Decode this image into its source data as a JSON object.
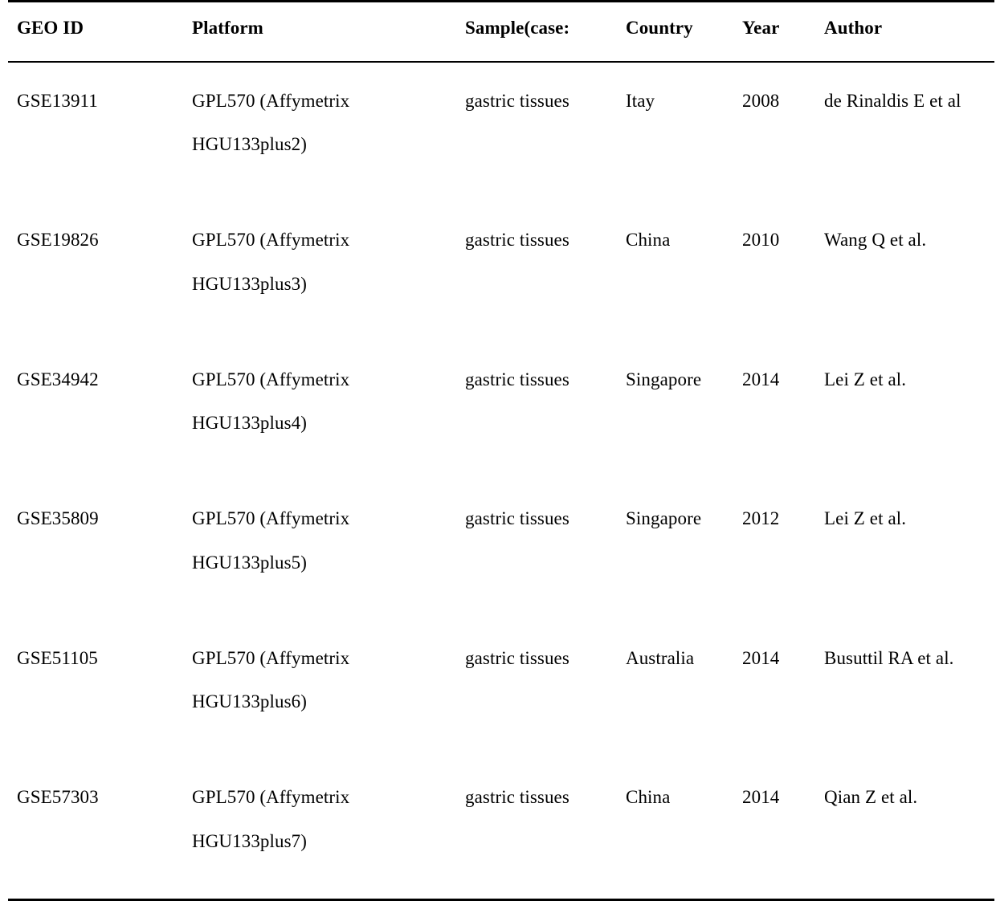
{
  "table": {
    "columns": [
      {
        "key": "geo_id",
        "label": "GEO ID"
      },
      {
        "key": "platform",
        "label": "Platform"
      },
      {
        "key": "sample",
        "label": "Sample(case:"
      },
      {
        "key": "country",
        "label": "Country"
      },
      {
        "key": "year",
        "label": "Year"
      },
      {
        "key": "author",
        "label": "Author"
      }
    ],
    "rows": [
      {
        "geo_id": "GSE13911",
        "platform_line1": "GPL570 (Affymetrix",
        "platform_line2": "HGU133plus2)",
        "sample": "gastric tissues",
        "country": "Itay",
        "year": "2008",
        "author": "de Rinaldis E et al"
      },
      {
        "geo_id": "GSE19826",
        "platform_line1": "GPL570 (Affymetrix",
        "platform_line2": "HGU133plus3)",
        "sample": "gastric tissues",
        "country": "China",
        "year": "2010",
        "author": "Wang Q et al."
      },
      {
        "geo_id": "GSE34942",
        "platform_line1": "GPL570 (Affymetrix",
        "platform_line2": "HGU133plus4)",
        "sample": "gastric tissues",
        "country": "Singapore",
        "year": "2014",
        "author": "Lei Z et al."
      },
      {
        "geo_id": "GSE35809",
        "platform_line1": "GPL570 (Affymetrix",
        "platform_line2": "HGU133plus5)",
        "sample": "gastric tissues",
        "country": "Singapore",
        "year": "2012",
        "author": "Lei Z et al."
      },
      {
        "geo_id": "GSE51105",
        "platform_line1": "GPL570 (Affymetrix",
        "platform_line2": "HGU133plus6)",
        "sample": "gastric tissues",
        "country": "Australia",
        "year": "2014",
        "author": "Busuttil RA et al."
      },
      {
        "geo_id": "GSE57303",
        "platform_line1": "GPL570 (Affymetrix",
        "platform_line2": "HGU133plus7)",
        "sample": "gastric tissues",
        "country": "China",
        "year": "2014",
        "author": "Qian Z et al."
      }
    ]
  },
  "colors": {
    "text": "#000000",
    "rule": "#000000",
    "background": "#ffffff"
  }
}
